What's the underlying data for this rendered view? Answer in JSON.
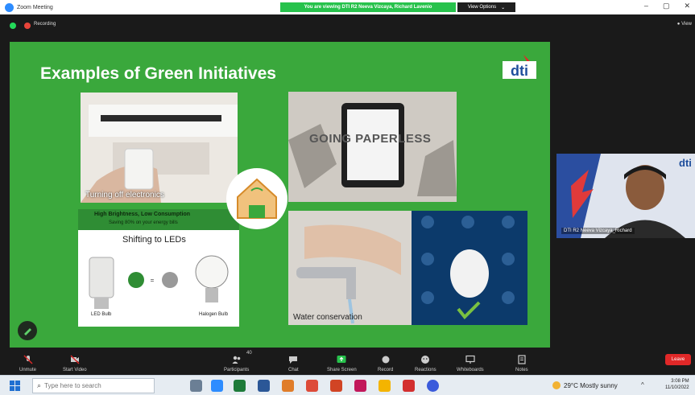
{
  "window": {
    "title": "Zoom Meeting"
  },
  "share_banner": {
    "text": "You are viewing DTI R2 Neeva Vizcaya, Richard Lavenio",
    "view_options": "View Options"
  },
  "meeting": {
    "recording_label": "Recording",
    "view_label": "View"
  },
  "slide": {
    "title": "Examples of Green Initiatives",
    "captions": {
      "electronics": "Turning off electronics",
      "paperless": "GOING PAPERLESS",
      "led_banner": "High Brightness, Low Consumption",
      "led_sub": "Saving 80% on your energy bills",
      "led_title": "Shifting to LEDs",
      "led_bulb": "LED Bulb",
      "halogen_bulb": "Halogen Bulb",
      "water": "Water conservation"
    }
  },
  "video": {
    "participant_name": "DTI R2 Neeva Vizcaya_Richard"
  },
  "toolbar": {
    "items": [
      {
        "label": "Unmute",
        "icon": "microphone-muted-icon"
      },
      {
        "label": "Start Video",
        "icon": "video-off-icon"
      },
      {
        "label": "Participants",
        "icon": "participants-icon",
        "count": "40"
      },
      {
        "label": "Chat",
        "icon": "chat-icon"
      },
      {
        "label": "Share Screen",
        "icon": "share-screen-icon"
      },
      {
        "label": "Record",
        "icon": "record-icon"
      },
      {
        "label": "Reactions",
        "icon": "reactions-icon"
      },
      {
        "label": "Whiteboards",
        "icon": "whiteboard-icon"
      },
      {
        "label": "Notes",
        "icon": "notes-icon"
      }
    ],
    "leave_label": "Leave"
  },
  "taskbar": {
    "search_placeholder": "Type here to search",
    "weather": "29°C  Mostly sunny",
    "time": "3:08 PM",
    "date": "11/10/2022"
  },
  "colors": {
    "slide_green": "#3aa83c",
    "zoom_blue": "#2d8cff",
    "leave_red": "#e02828",
    "share_green": "#27c24c"
  }
}
